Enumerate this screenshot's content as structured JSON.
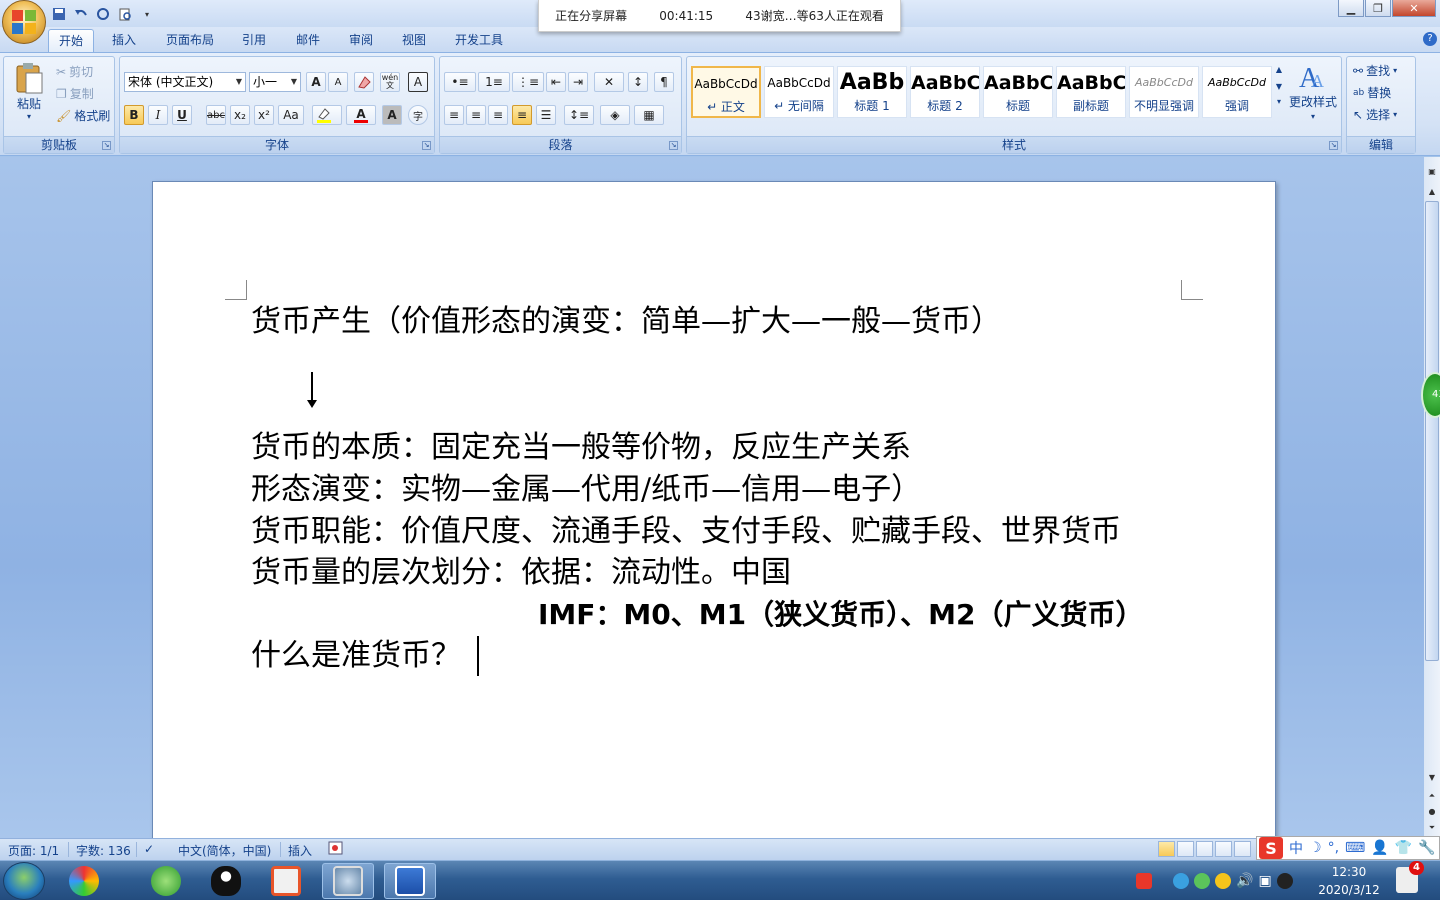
{
  "share_banner": {
    "sharing": "正在分享屏幕",
    "time": "00:41:15",
    "viewers": "43谢宽…等63人正在观看"
  },
  "tabs": [
    {
      "label": "开始",
      "active": true
    },
    {
      "label": "插入"
    },
    {
      "label": "页面布局"
    },
    {
      "label": "引用"
    },
    {
      "label": "邮件"
    },
    {
      "label": "审阅"
    },
    {
      "label": "视图"
    },
    {
      "label": "开发工具"
    }
  ],
  "clipboard": {
    "paste": "粘贴",
    "cut": "剪切",
    "copy": "复制",
    "format_painter": "格式刷",
    "label": "剪贴板"
  },
  "font": {
    "name": "宋体 (中文正文)",
    "size": "小一",
    "label": "字体",
    "grow": "A",
    "shrink": "A",
    "bold": "B",
    "italic": "I",
    "underline": "U",
    "strike": "abc",
    "sub": "x₂",
    "sup": "x²",
    "case": "Aa",
    "wen": "wén",
    "wen_char": "文",
    "border_char": "A",
    "color_char": "A",
    "shade_char": "A",
    "enclose_char": "字"
  },
  "paragraph": {
    "label": "段落"
  },
  "styles": {
    "label": "样式",
    "items": [
      {
        "preview": "AaBbCcDd",
        "name": "↵ 正文",
        "selected": true
      },
      {
        "preview": "AaBbCcDd",
        "name": "↵ 无间隔"
      },
      {
        "preview": "AaBb",
        "name": "标题 1"
      },
      {
        "preview": "AaBbC",
        "name": "标题 2"
      },
      {
        "preview": "AaBbC",
        "name": "标题"
      },
      {
        "preview": "AaBbC",
        "name": "副标题"
      },
      {
        "preview": "AaBbCcDd",
        "name": "不明显强调"
      },
      {
        "preview": "AaBbCcDd",
        "name": "强调"
      }
    ],
    "change_styles": "更改样式"
  },
  "editing": {
    "find": "查找",
    "replace": "替换",
    "select": "选择",
    "label": "编辑"
  },
  "document": {
    "lines": [
      "货币产生（价值形态的演变：简单—扩大—一般—货币）",
      "货币的本质：固定充当一般等价物，反应生产关系",
      "形态演变：实物—金属—代用/纸币—信用—电子）",
      "货币职能：价值尺度、流通手段、支付手段、贮藏手段、世界货币",
      "货币量的层次划分：依据：流动性。中国",
      "IMF：M0、M1（狭义货币）、M2（广义货币）",
      "什么是准货币？"
    ]
  },
  "side_badge": "43",
  "status": {
    "page": "页面: 1/1",
    "words": "字数: 136",
    "language": "中文(简体，中国)",
    "mode": "插入"
  },
  "ime": {
    "logo": "S",
    "lang": "中"
  },
  "clock": {
    "time": "12:30",
    "date": "2020/3/12"
  },
  "notifications": "4"
}
